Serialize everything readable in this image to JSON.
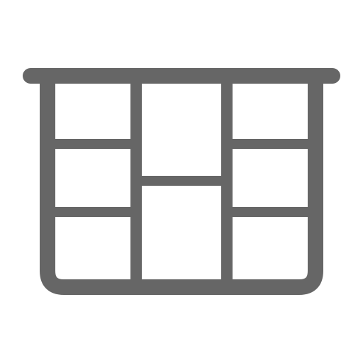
{
  "icon": {
    "name": "cabinet-drawers-icon",
    "stroke_color": "#666666",
    "background_color": "#ffffff"
  }
}
